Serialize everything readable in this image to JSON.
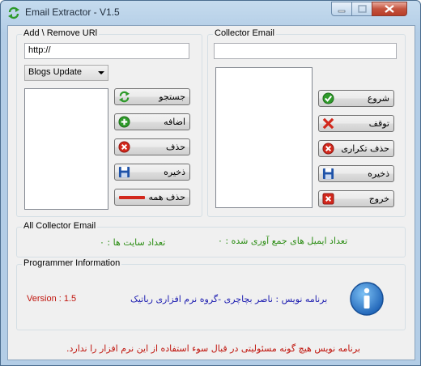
{
  "window": {
    "title": "Email Extractor - V1.5"
  },
  "url_group": {
    "label": "Add \\ Remove URl",
    "url_value": "http://",
    "selected_option": "Blogs Update",
    "buttons": {
      "search": "جستجو",
      "add": "اضافه",
      "remove": "حذف",
      "save": "ذخیره",
      "remove_all": "حذف همه"
    }
  },
  "collector_group": {
    "label": "Collector Email",
    "input_value": "",
    "buttons": {
      "start": "شروع",
      "stop": "توقف",
      "remove_duplicate": "حذف تکراری",
      "save": "ذخیره",
      "exit": "خروج"
    }
  },
  "stats_group": {
    "label": "All Collector Email",
    "sites_count": "تعداد سایت ها :  ۰",
    "emails_count": "تعداد ایمیل های جمع آوری شده :  ۰"
  },
  "programmer_group": {
    "label": "Programmer Information",
    "version": "Version : 1.5",
    "author": "برنامه نویس : ناصر بچاچری -گروه نرم افزاری رباتیک"
  },
  "disclaimer": "برنامه نویس هیچ گونه مسئولیتی در قبال سوء استفاده از این نرم افزار را ندارد.",
  "colors": {
    "stats_text": "#2a8c12",
    "version_text": "#c0140c",
    "author_text": "#1b1bb0",
    "disclaimer_text": "#c0140c"
  }
}
